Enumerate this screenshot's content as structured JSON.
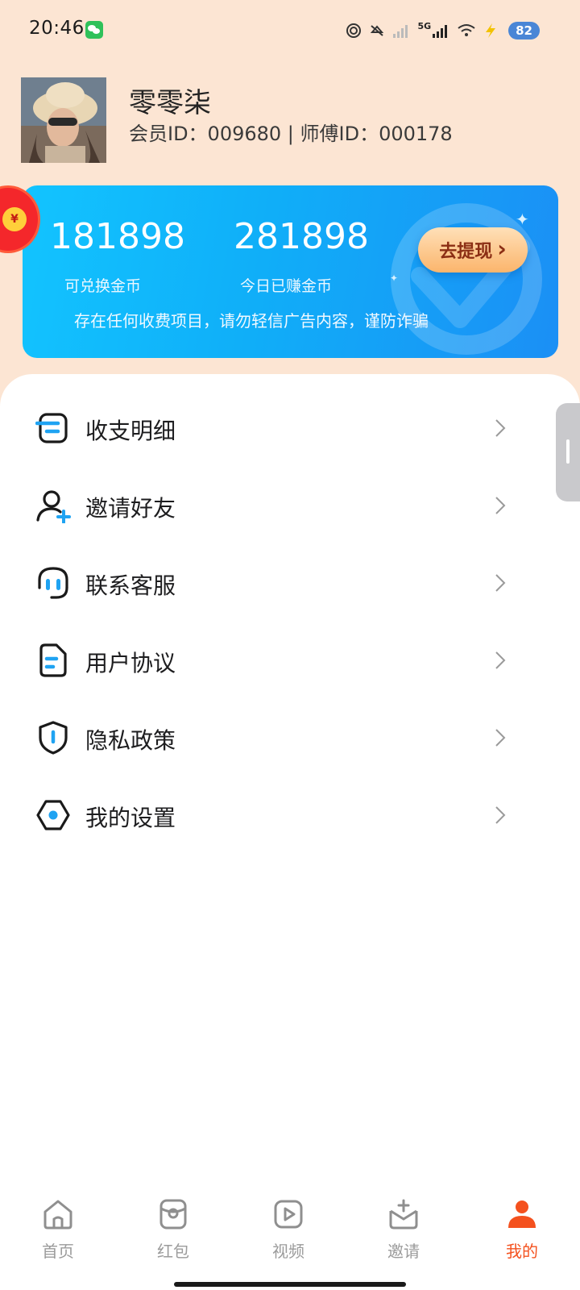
{
  "status_bar": {
    "time": "20:46",
    "network": "5G",
    "battery": "82"
  },
  "profile": {
    "name": "零零柒",
    "ids": "会员ID：009680 | 师傅ID：000178"
  },
  "coin_card": {
    "exchangeable_value": "181898",
    "exchangeable_label": "可兑换金币",
    "today_value": "281898",
    "today_label": "今日已赚金币",
    "notice": "存在任何收费项目，请勿轻信广告内容，谨防诈骗",
    "withdraw_label": "去提现",
    "withdraw_arrow": "›",
    "sparkle": "✦"
  },
  "red_packet": {
    "symbol": "¥"
  },
  "menu": {
    "items": [
      {
        "label": "收支明细",
        "icon": "ledger-icon"
      },
      {
        "label": "邀请好友",
        "icon": "add-user-icon"
      },
      {
        "label": "联系客服",
        "icon": "headset-icon"
      },
      {
        "label": "用户协议",
        "icon": "document-icon"
      },
      {
        "label": "隐私政策",
        "icon": "shield-icon"
      },
      {
        "label": "我的设置",
        "icon": "settings-icon"
      }
    ]
  },
  "bottom_nav": {
    "items": [
      {
        "label": "首页",
        "icon": "home-icon"
      },
      {
        "label": "红包",
        "icon": "red-packet-icon"
      },
      {
        "label": "视频",
        "icon": "video-icon"
      },
      {
        "label": "邀请",
        "icon": "invite-icon"
      },
      {
        "label": "我的",
        "icon": "profile-icon"
      }
    ],
    "active_index": 4
  },
  "colors": {
    "page_background": "#fce5d3",
    "card_blue": "#12b4fb",
    "accent_blue": "#1fa3f2",
    "active_nav": "#f4511e"
  }
}
